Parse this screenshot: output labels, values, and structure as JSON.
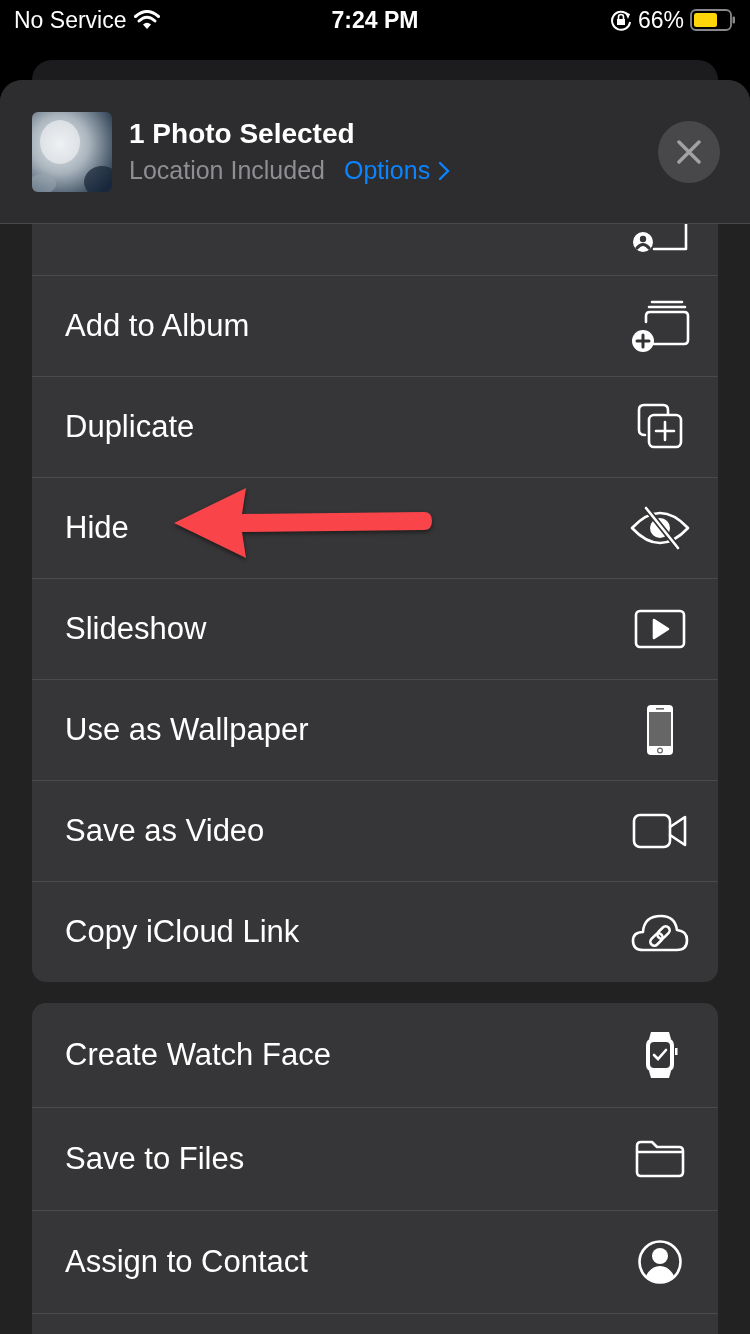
{
  "status_bar": {
    "carrier": "No Service",
    "time": "7:24 PM",
    "battery": "66%"
  },
  "header": {
    "title": "1 Photo Selected",
    "subtitle": "Location Included",
    "options_link": "Options"
  },
  "groups": [
    {
      "items": [
        {
          "pointed": false
        },
        {
          "label": "Add to Album",
          "pointed": false
        },
        {
          "label": "Duplicate",
          "pointed": false
        },
        {
          "label": "Hide",
          "pointed": true
        },
        {
          "label": "Slideshow",
          "pointed": false
        },
        {
          "label": "Use as Wallpaper",
          "pointed": false
        },
        {
          "label": "Save as Video",
          "pointed": false
        },
        {
          "label": "Copy iCloud Link",
          "pointed": false
        }
      ]
    },
    {
      "items": [
        {
          "label": "Create Watch Face",
          "pointed": false
        },
        {
          "label": "Save to Files",
          "pointed": false
        },
        {
          "label": "Assign to Contact",
          "pointed": false
        }
      ]
    }
  ]
}
